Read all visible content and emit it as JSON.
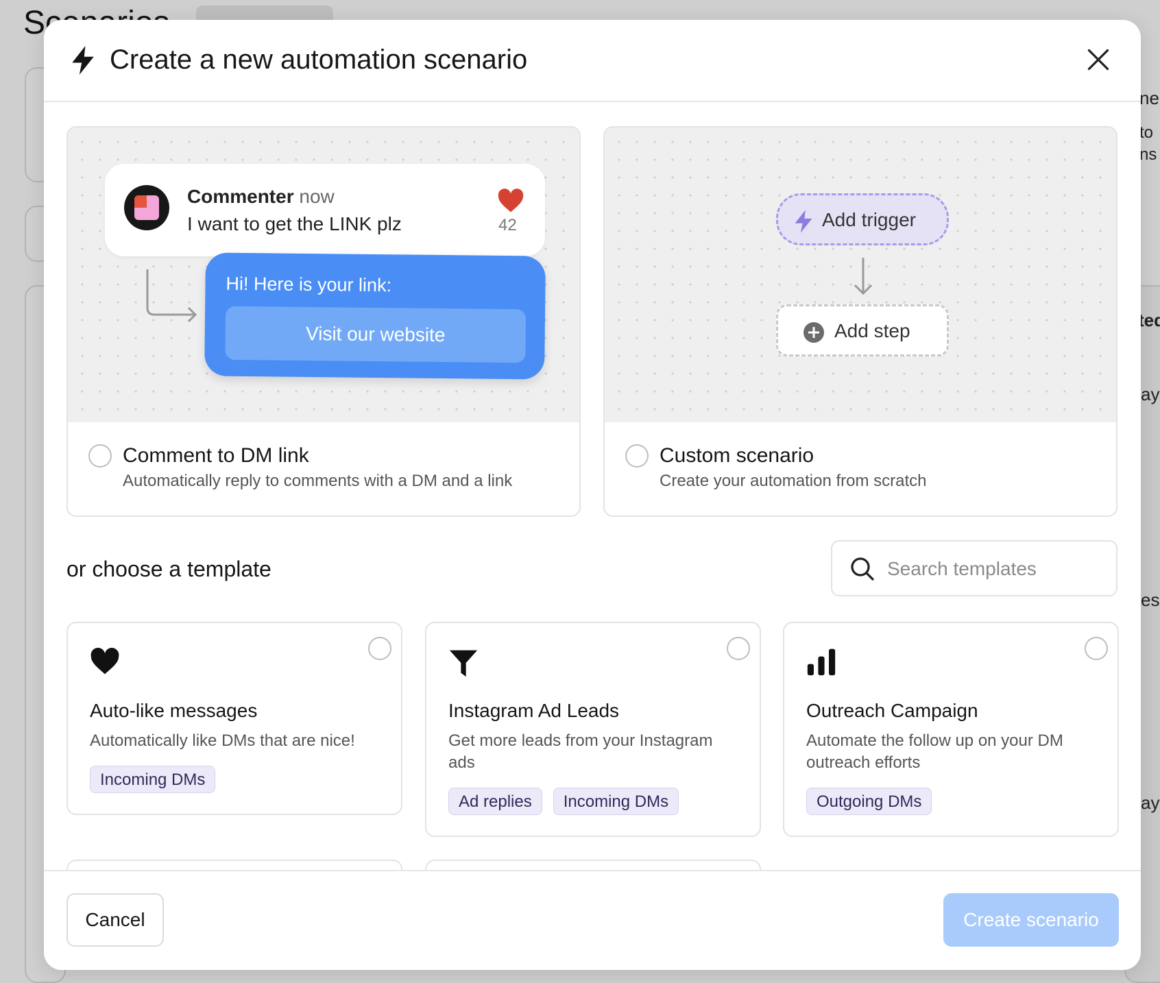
{
  "background": {
    "page_title": "Scenarios",
    "fragments": [
      "ne",
      "to",
      "ns",
      "ted",
      "ay",
      "es",
      "ay"
    ]
  },
  "modal": {
    "title": "Create a new automation scenario",
    "icons": {
      "title": "bolt-icon",
      "close": "close-icon"
    },
    "options": [
      {
        "title": "Comment to DM link",
        "description": "Automatically reply to comments with a DM and a link",
        "illustration": {
          "commenter_name": "Commenter",
          "commenter_time": "now",
          "comment_text": "I want to get the LINK plz",
          "like_count": "42",
          "dm_text": "Hi! Here is your link:",
          "dm_link_label": "Visit our website"
        }
      },
      {
        "title": "Custom scenario",
        "description": "Create your automation from scratch",
        "illustration": {
          "add_trigger_label": "Add trigger",
          "add_step_label": "Add step"
        }
      }
    ],
    "templates_section": {
      "title": "or choose a template",
      "search_placeholder": "Search templates",
      "search_value": ""
    },
    "templates": [
      {
        "icon": "heart-icon",
        "title": "Auto-like messages",
        "description": "Automatically like DMs that are nice!",
        "tags": [
          "Incoming DMs"
        ]
      },
      {
        "icon": "funnel-icon",
        "title": "Instagram Ad Leads",
        "description": "Get more leads from your Instagram ads",
        "tags": [
          "Ad replies",
          "Incoming DMs"
        ]
      },
      {
        "icon": "bar-chart-icon",
        "title": "Outreach Campaign",
        "description": "Automate the follow up on your DM outreach efforts",
        "tags": [
          "Outgoing DMs"
        ]
      }
    ],
    "footer": {
      "cancel_label": "Cancel",
      "create_label": "Create scenario"
    },
    "colors": {
      "primary_disabled": "#a9cbfb",
      "dm_bubble": "#4a8ef5",
      "tag_bg": "#eceaf8",
      "trigger_accent": "#a99ae6"
    }
  }
}
